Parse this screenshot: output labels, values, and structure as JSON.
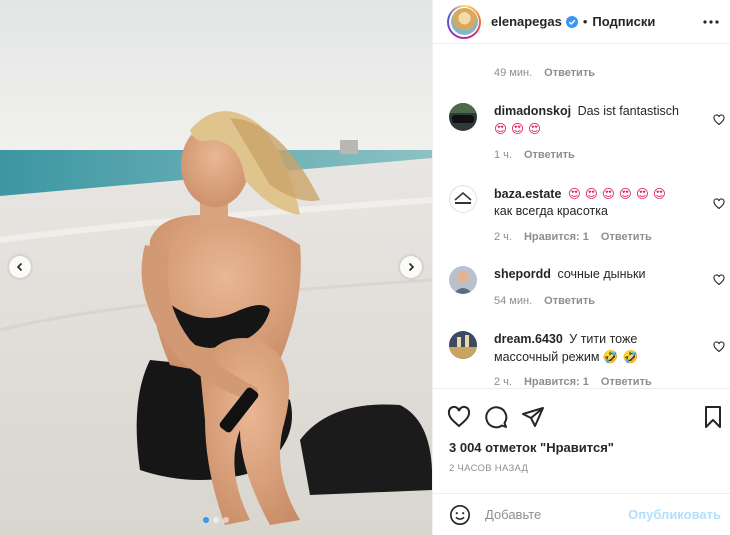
{
  "post": {
    "username": "elenapegas",
    "follow_label": "Подписки",
    "dot": "•",
    "likes": "3 004 отметок \"Нравится\"",
    "time_ago": "2 ЧАСОВ НАЗАД"
  },
  "comments": [
    {
      "user": "",
      "text": "",
      "time": "49 мин.",
      "likes": "",
      "reply": "Ответить",
      "emoji": ""
    },
    {
      "user": "dimadonskoj",
      "text": "Das ist fantastisch",
      "time": "1 ч.",
      "likes": "",
      "reply": "Ответить",
      "emoji": "😍 😍 😍"
    },
    {
      "user": "baza.estate",
      "text": "как всегда красотка",
      "time": "2 ч.",
      "likes": "Нравится: 1",
      "reply": "Ответить",
      "emoji": "😍 😍 😍 😍 😍 😍"
    },
    {
      "user": "shepordd",
      "text": "сочные дыньки",
      "time": "54 мин.",
      "likes": "",
      "reply": "Ответить",
      "emoji": ""
    },
    {
      "user": "dream.6430",
      "text": "У тити тоже массочный режим",
      "time": "2 ч.",
      "likes": "Нравится: 1",
      "reply": "Ответить",
      "emoji": "🤣 🤣"
    }
  ],
  "add_comment": {
    "placeholder": "Добавьте",
    "publish_label": "Опубликовать"
  },
  "colors": {
    "verified": "#3897f0",
    "publish_disabled": "#b2dffc",
    "meta_gray": "#8e8e8e"
  },
  "icons": [
    "chevron-left-icon",
    "chevron-right-icon",
    "verified-icon",
    "more-icon",
    "heart-icon",
    "comment-icon",
    "share-icon",
    "save-icon",
    "smile-icon"
  ]
}
